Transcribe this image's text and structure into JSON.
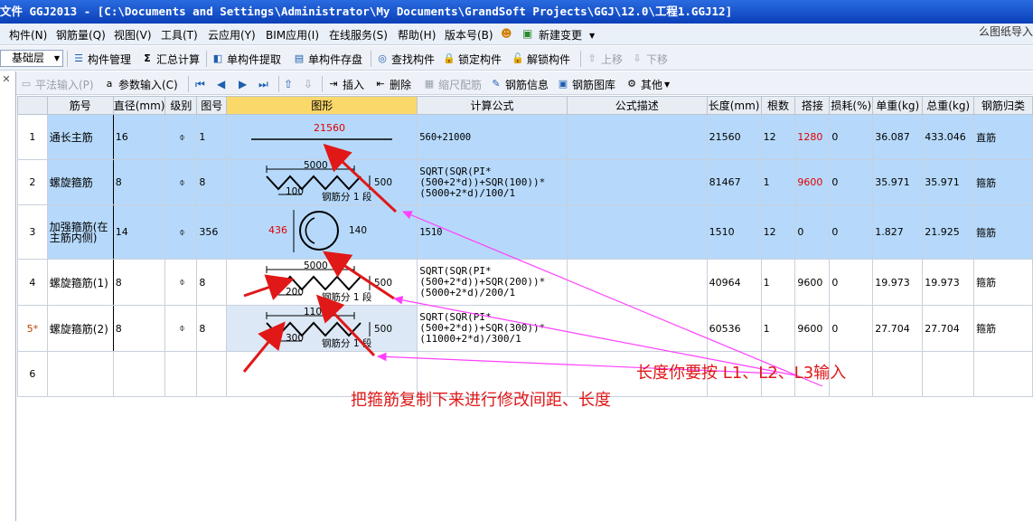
{
  "window": {
    "title": "文件 GGJ2013 - [C:\\Documents and Settings\\Administrator\\My Documents\\GrandSoft Projects\\GGJ\\12.0\\工程1.GGJ12]"
  },
  "menu": {
    "items": [
      "构件(N)",
      "钢筋量(Q)",
      "视图(V)",
      "工具(T)",
      "云应用(Y)",
      "BIM应用(I)",
      "在线服务(S)",
      "帮助(H)",
      "版本号(B)",
      "新建变更"
    ],
    "right_text": "么图纸导入"
  },
  "toolbar1": {
    "floor": "基础层",
    "buttons": [
      "构件管理",
      "汇总计算",
      "单构件提取",
      "单构件存盘",
      "查找构件",
      "锁定构件",
      "解锁构件",
      "上移",
      "下移"
    ]
  },
  "toolbar2": {
    "buttons": [
      "平法输入(P)",
      "参数输入(C)",
      "插入",
      "删除",
      "缩尺配筋",
      "钢筋信息",
      "钢筋图库",
      "其他"
    ]
  },
  "table": {
    "columns": [
      "",
      "筋号",
      "直径(mm)",
      "级别",
      "图号",
      "图形",
      "计算公式",
      "公式描述",
      "长度(mm)",
      "根数",
      "搭接",
      "损耗(%)",
      "单重(kg)",
      "总重(kg)",
      "钢筋归类"
    ],
    "rows": [
      {
        "no": "1",
        "name": "通长主筋",
        "dia": "16",
        "grade": "⌽",
        "fig_no": "1",
        "fig": {
          "kind": "line",
          "L": "21560"
        },
        "formula": "560+21000",
        "desc": "",
        "length": "21560",
        "count": "12",
        "lap": "1280",
        "loss": "0",
        "unit_w": "36.087",
        "total_w": "433.046",
        "cat": "直筋"
      },
      {
        "no": "2",
        "name": "螺旋箍筋",
        "dia": "8",
        "grade": "⌽",
        "fig_no": "8",
        "fig": {
          "kind": "spiral",
          "L": "5000",
          "spacing": "100",
          "h": "500",
          "label": "钢筋分 1 段"
        },
        "formula": "SQRT(SQR(PI*(500+2*d))+SQR(100))*(5000+2*d)/100/1",
        "desc": "",
        "length": "81467",
        "count": "1",
        "lap": "9600",
        "loss": "0",
        "unit_w": "35.971",
        "total_w": "35.971",
        "cat": "箍筋"
      },
      {
        "no": "3",
        "name": "加强箍筋(在主筋内侧)",
        "dia": "14",
        "grade": "⌽",
        "fig_no": "356",
        "fig": {
          "kind": "ring",
          "len": "436",
          "d": "140"
        },
        "formula": "1510",
        "desc": "",
        "length": "1510",
        "count": "12",
        "lap": "0",
        "loss": "0",
        "unit_w": "1.827",
        "total_w": "21.925",
        "cat": "箍筋"
      },
      {
        "no": "4",
        "name": "螺旋箍筋(1)",
        "dia": "8",
        "grade": "⌽",
        "fig_no": "8",
        "fig": {
          "kind": "spiral",
          "L": "5000",
          "spacing": "200",
          "h": "500",
          "label": "钢筋分 1 段"
        },
        "formula": "SQRT(SQR(PI*(500+2*d))+SQR(200))*(5000+2*d)/200/1",
        "desc": "",
        "length": "40964",
        "count": "1",
        "lap": "9600",
        "loss": "0",
        "unit_w": "19.973",
        "total_w": "19.973",
        "cat": "箍筋"
      },
      {
        "no": "5*",
        "name": "螺旋箍筋(2)",
        "dia": "8",
        "grade": "⌽",
        "fig_no": "8",
        "fig": {
          "kind": "spiral",
          "L": "11000",
          "spacing": "300",
          "h": "500",
          "label": "钢筋分 1 段"
        },
        "formula": "SQRT(SQR(PI*(500+2*d))+SQR(300))*(11000+2*d)/300/1",
        "desc": "",
        "length": "60536",
        "count": "1",
        "lap": "9600",
        "loss": "0",
        "unit_w": "27.704",
        "total_w": "27.704",
        "cat": "箍筋"
      },
      {
        "no": "6",
        "name": "",
        "dia": "",
        "grade": "",
        "fig_no": "",
        "fig": {
          "kind": "none"
        },
        "formula": "",
        "desc": "",
        "length": "",
        "count": "",
        "lap": "",
        "loss": "",
        "unit_w": "",
        "total_w": "",
        "cat": ""
      }
    ]
  },
  "annotations": {
    "length_note": "长度你要按  L1、L2、L3输入",
    "copy_note": "把箍筋复制下来进行修改间距、长度"
  },
  "colors": {
    "selected_row": "#b6d9fb",
    "header_highlight": "#fbd86a",
    "title_bar": "#0a3fb8",
    "annotation_red": "#e01818",
    "arrow_magenta": "#ff40ff"
  }
}
